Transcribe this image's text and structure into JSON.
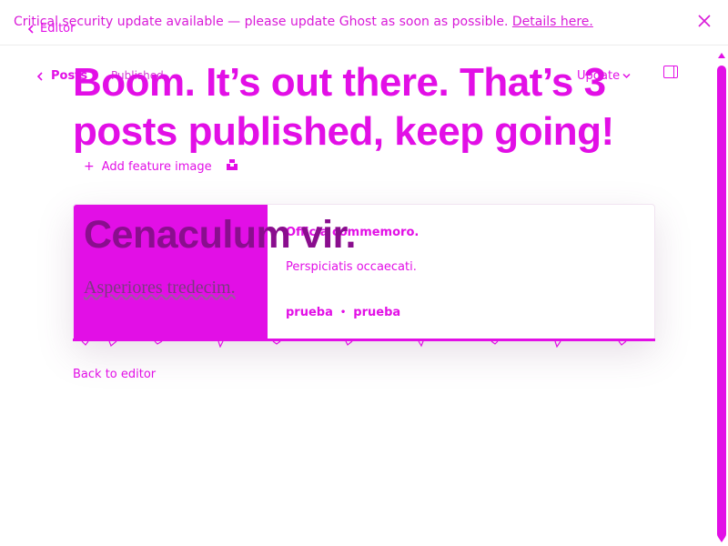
{
  "banner": {
    "message": "Critical security update available — please update Ghost as soon as possible.",
    "link_label": "Details here."
  },
  "editor_link": {
    "label": "Editor"
  },
  "editor_header": {
    "posts_label": "Posts",
    "status_label": "Published",
    "update_label": "Update"
  },
  "publish_complete": {
    "headline": "Boom. It’s out there. That’s 3 posts published, keep going!",
    "add_feature_image": "Add feature image",
    "back_to_editor": "Back to editor"
  },
  "bookmark_card": {
    "image_title": "Cenaculum vir.",
    "image_subtitle": "Asperiores tredecim.",
    "title": "Officia commemoro.",
    "excerpt": "Perspiciatis occaecati.",
    "author": "prueba",
    "publisher": "prueba"
  },
  "icons": {
    "back": "chevron-left-icon",
    "close": "close-icon",
    "plus": "plus-icon",
    "unsplash": "unsplash-icon",
    "sidebar": "sidebar-toggle-icon",
    "chevron": "chevron-down-icon"
  },
  "colors": {
    "accent": "#e20fe6",
    "card_title_overlay": "#8a0e8e"
  }
}
